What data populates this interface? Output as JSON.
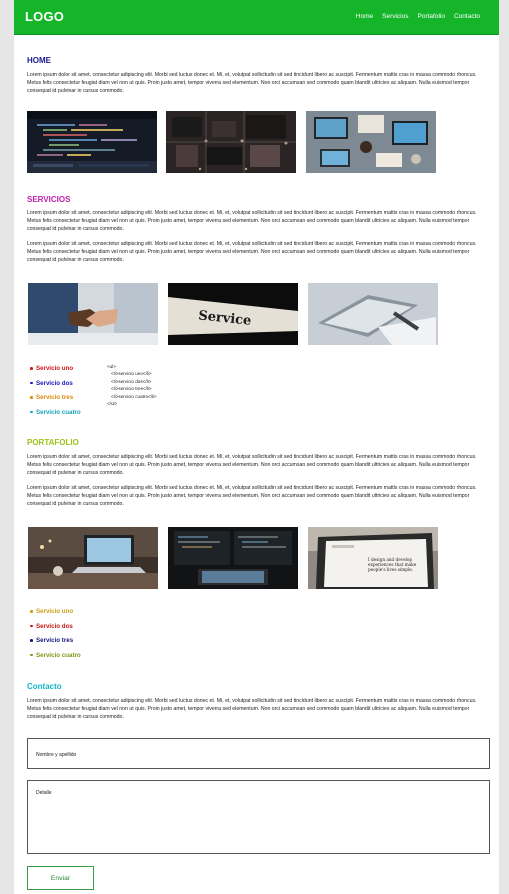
{
  "header": {
    "logo": "LOGO",
    "nav": [
      "Home",
      "Servicios",
      "Portafolio",
      "Contacto"
    ]
  },
  "home": {
    "title": "HOME",
    "paragraph": "Lorem ipsum dolor sit amet, consectetur adipiscing elit. Morbi sed luctus donec et. Mi, et, volutpat sollicitudin sit sed tincidunt libero ac suscipit. Fermentum mattis cras in massa commodo rhoncus. Metus felis consectetur feugiat diam vel non ut quis. Proin justo amet, tempor viverra sed elementum. Non orci accumsan sed commodo quam blandit ultricies ac aliquam. Nulla euismod tempor consequat id pulvinar in cursus commodo."
  },
  "servicios": {
    "title": "SERVICIOS",
    "paragraphs": [
      "Lorem ipsum dolor sit amet, consectetur adipiscing elit. Morbi sed luctus donec et. Mi, et, volutpat sollicitudin sit sed tincidunt libero ac suscipit. Fermentum mattis cras in massa commodo rhoncus. Metus felis consectetur feugiat diam vel non ut quis. Proin justo amet, tempor viverra sed elementum. Non orci accumsan sed commodo quam blandit ultricies ac aliquam. Nulla euismod tempor consequat id pulvinar in cursus commodo.",
      "Lorem ipsum dolor sit amet, consectetur adipiscing elit. Morbi sed luctus donec et. Mi, et, volutpat sollicitudin sit sed tincidunt libero ac suscipit. Fermentum mattis cras in massa commodo rhoncus. Metus felis consectetur feugiat diam vel non ut quis. Proin justo amet, tempor viverra sed elementum. Non orci accumsan sed commodo quam blandit ultricies ac aliquam. Nulla euismod tempor consequat id pulvinar in cursus commodo."
    ],
    "service_sign_text": "Service",
    "list": [
      "Servicio uno",
      "Servicio dos",
      "Servicio tres",
      "Servicio cuatro"
    ],
    "code_lines": [
      "<ul>",
      "<li>servicio uno</li>",
      "<li>servicio dos</li>",
      "<li>servicio tres</li>",
      "<li>servicio cuatro</li>",
      "</ul>"
    ]
  },
  "portafolio": {
    "title": "PORTAFOLIO",
    "paragraphs": [
      "Lorem ipsum dolor sit amet, consectetur adipiscing elit. Morbi sed luctus donec et. Mi, et, volutpat sollicitudin sit sed tincidunt libero ac suscipit. Fermentum mattis cras in massa commodo rhoncus. Metus felis consectetur feugiat diam vel non ut quis. Proin justo amet, tempor viverra sed elementum. Non orci accumsan sed commodo quam blandit ultricies ac aliquam. Nulla euismod tempor consequat id pulvinar in cursus commodo.",
      "Lorem ipsum dolor sit amet, consectetur adipiscing elit. Morbi sed luctus donec et. Mi, et, volutpat sollicitudin sit sed tincidunt libero ac suscipit. Fermentum mattis cras in massa commodo rhoncus. Metus felis consectetur feugiat diam vel non ut quis. Proin justo amet, tempor viverra sed elementum. Non orci accumsan sed commodo quam blandit ultricies ac aliquam. Nulla euismod tempor consequat id pulvinar in cursus commodo."
    ],
    "screen_text": "I design and develop experiences that make people's lives simple.",
    "list": [
      "Servicio uno",
      "Servicio dos",
      "Servicio tres",
      "Servicio cuatro"
    ]
  },
  "contacto": {
    "title": "Contacto",
    "paragraph": "Lorem ipsum dolor sit amet, consectetur adipiscing elit. Morbi sed luctus donec et. Mi, et, volutpat sollicitudin sit sed tincidunt libero ac suscipit. Fermentum mattis cras in massa commodo rhoncus. Metus felis consectetur feugiat diam vel non ut quis. Proin justo amet, tempor viverra sed elementum. Non orci accumsan sed commodo quam blandit ultricies ac aliquam. Nulla euismod tempor consequat id pulvinar in cursus commodo.",
    "name_placeholder": "Nombre y apellido",
    "detail_placeholder": "Detalle",
    "submit_label": "Enviar"
  },
  "colors": {
    "header_bg": "#15b52a",
    "home_title": "#1a1a8c",
    "servicios_title": "#c21fb0",
    "portafolio_title": "#9dc21a",
    "contacto_title": "#12b5c9",
    "servicios_list": [
      "#d01414",
      "#1515c4",
      "#d98a0c",
      "#14a3b5"
    ],
    "portafolio_list": [
      "#c8a014",
      "#c81414",
      "#151580",
      "#7a9a14"
    ]
  }
}
